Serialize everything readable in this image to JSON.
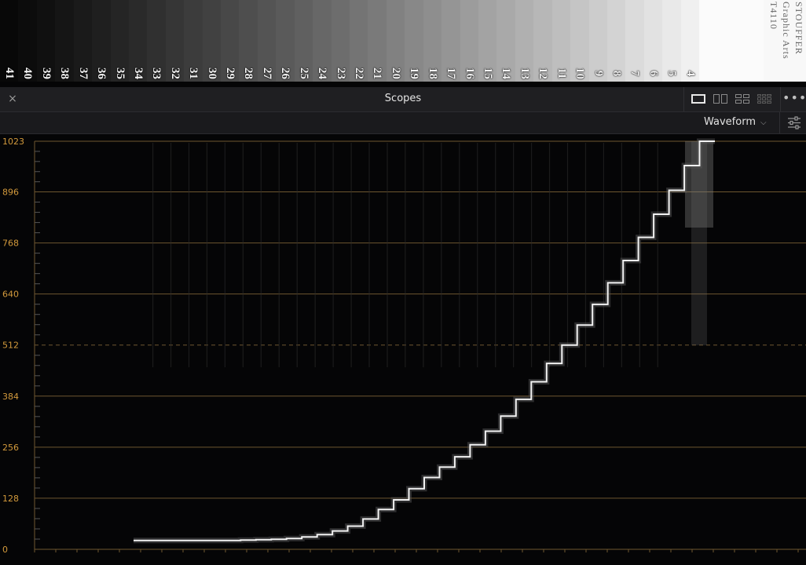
{
  "wedge": {
    "steps": [
      "41",
      "40",
      "39",
      "38",
      "37",
      "36",
      "35",
      "34",
      "33",
      "32",
      "31",
      "30",
      "29",
      "28",
      "27",
      "26",
      "25",
      "24",
      "23",
      "22",
      "21",
      "20",
      "19",
      "18",
      "17",
      "16",
      "15",
      "14",
      "13",
      "12",
      "11",
      "10",
      "9",
      "8",
      "7",
      "6",
      "5",
      "4"
    ],
    "brand_lines": [
      "STOUFFER",
      "Graphic Arts",
      "T4110"
    ]
  },
  "header": {
    "title": "Scopes",
    "close_icon": "×",
    "more_icon": "•••"
  },
  "toolbar": {
    "scope_type": "Waveform",
    "chevron": "⌵"
  },
  "scope": {
    "y_ticks": [
      "1023",
      "896",
      "768",
      "640",
      "512",
      "384",
      "256",
      "128",
      "0"
    ],
    "y_max": 1023,
    "label_color": "#d39a3c",
    "line_color": "#6e5630",
    "trace_color": "#f2f2f2",
    "step_levels": [
      22,
      22,
      22,
      22,
      22,
      22,
      22,
      23,
      24,
      25,
      27,
      31,
      37,
      46,
      58,
      76,
      100,
      124,
      152,
      180,
      206,
      232,
      262,
      296,
      334,
      376,
      420,
      466,
      512,
      562,
      614,
      668,
      724,
      782,
      840,
      900,
      962,
      1023
    ]
  }
}
